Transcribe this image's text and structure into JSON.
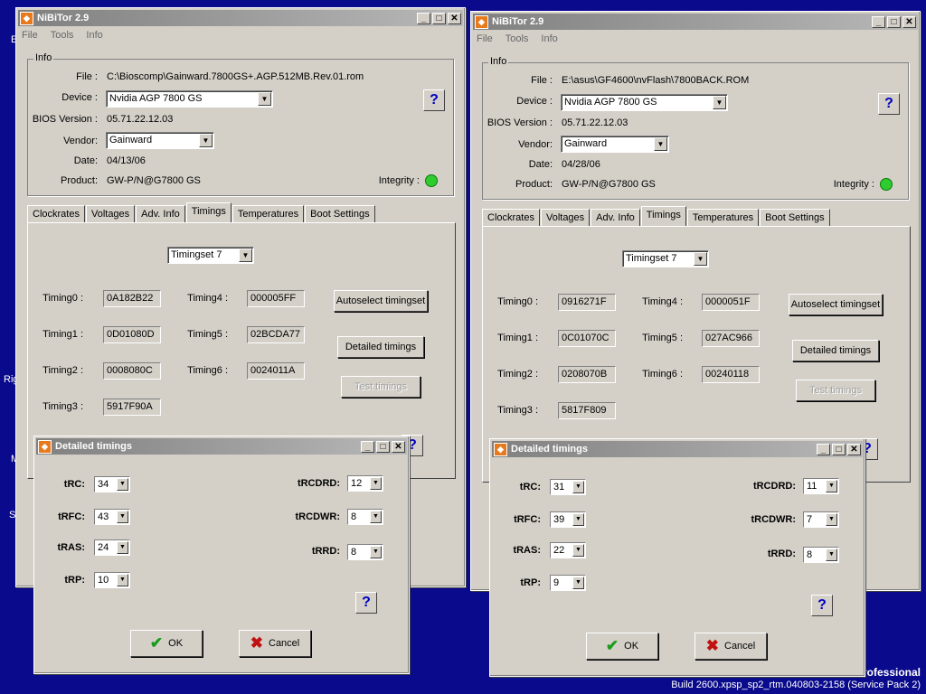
{
  "desktop": {
    "edge_labels": [
      "E",
      "Rig",
      "M",
      "Se"
    ],
    "os_edition": "rofessional",
    "build": "Build 2600.xpsp_sp2_rtm.040803-2158 (Service Pack 2)"
  },
  "windows": [
    {
      "title": "NiBiTor 2.9",
      "menu": [
        "File",
        "Tools",
        "Info"
      ],
      "info_legend": "Info",
      "labels": {
        "file": "File :",
        "device": "Device :",
        "bios": "BIOS Version :",
        "vendor": "Vendor:",
        "date": "Date:",
        "product": "Product:",
        "integrity": "Integrity :"
      },
      "file": "C:\\Bioscomp\\Gainward.7800GS+.AGP.512MB.Rev.01.rom",
      "device": "Nvidia AGP 7800 GS",
      "bios_version": "05.71.22.12.03",
      "vendor": "Gainward",
      "date": "04/13/06",
      "product": "GW-P/N@G7800 GS",
      "integrity_color": "#2ecc2e",
      "tabs": [
        "Clockrates",
        "Voltages",
        "Adv. Info",
        "Timings",
        "Temperatures",
        "Boot Settings"
      ],
      "active_tab": "Timings",
      "timingset": "Timingset 7",
      "timings": [
        {
          "label": "Timing0 :",
          "value": "0A182B22"
        },
        {
          "label": "Timing1 :",
          "value": "0D01080D"
        },
        {
          "label": "Timing2 :",
          "value": "0008080C"
        },
        {
          "label": "Timing3 :",
          "value": "5917F90A"
        },
        {
          "label": "Timing4 :",
          "value": "000005FF"
        },
        {
          "label": "Timing5 :",
          "value": "02BCDA77"
        },
        {
          "label": "Timing6 :",
          "value": "0024011A"
        }
      ],
      "buttons": {
        "autoselect": "Autoselect timingset",
        "detailed": "Detailed timings",
        "test": "Test timings"
      },
      "dialog": {
        "title": "Detailed timings",
        "params": [
          {
            "label": "tRC:",
            "value": "34"
          },
          {
            "label": "tRFC:",
            "value": "43"
          },
          {
            "label": "tRAS:",
            "value": "24"
          },
          {
            "label": "tRP:",
            "value": "10"
          },
          {
            "label": "tRCDRD:",
            "value": "12"
          },
          {
            "label": "tRCDWR:",
            "value": "8"
          },
          {
            "label": "tRRD:",
            "value": "8"
          }
        ],
        "ok": "OK",
        "cancel": "Cancel"
      }
    },
    {
      "title": "NiBiTor 2.9",
      "menu": [
        "File",
        "Tools",
        "Info"
      ],
      "info_legend": "Info",
      "labels": {
        "file": "File :",
        "device": "Device :",
        "bios": "BIOS Version :",
        "vendor": "Vendor:",
        "date": "Date:",
        "product": "Product:",
        "integrity": "Integrity :"
      },
      "file": "E:\\asus\\GF4600\\nvFlash\\7800BACK.ROM",
      "device": "Nvidia AGP 7800 GS",
      "bios_version": "05.71.22.12.03",
      "vendor": "Gainward",
      "date": "04/28/06",
      "product": "GW-P/N@G7800 GS",
      "integrity_color": "#2ecc2e",
      "tabs": [
        "Clockrates",
        "Voltages",
        "Adv. Info",
        "Timings",
        "Temperatures",
        "Boot Settings"
      ],
      "active_tab": "Timings",
      "timingset": "Timingset 7",
      "timings": [
        {
          "label": "Timing0 :",
          "value": "0916271F"
        },
        {
          "label": "Timing1 :",
          "value": "0C01070C"
        },
        {
          "label": "Timing2 :",
          "value": "0208070B"
        },
        {
          "label": "Timing3 :",
          "value": "5817F809"
        },
        {
          "label": "Timing4 :",
          "value": "0000051F"
        },
        {
          "label": "Timing5 :",
          "value": "027AC966"
        },
        {
          "label": "Timing6 :",
          "value": "00240118"
        }
      ],
      "buttons": {
        "autoselect": "Autoselect timingset",
        "detailed": "Detailed timings",
        "test": "Test timings"
      },
      "dialog": {
        "title": "Detailed timings",
        "params": [
          {
            "label": "tRC:",
            "value": "31"
          },
          {
            "label": "tRFC:",
            "value": "39"
          },
          {
            "label": "tRAS:",
            "value": "22"
          },
          {
            "label": "tRP:",
            "value": "9"
          },
          {
            "label": "tRCDRD:",
            "value": "11"
          },
          {
            "label": "tRCDWR:",
            "value": "7"
          },
          {
            "label": "tRRD:",
            "value": "8"
          }
        ],
        "ok": "OK",
        "cancel": "Cancel"
      }
    }
  ]
}
